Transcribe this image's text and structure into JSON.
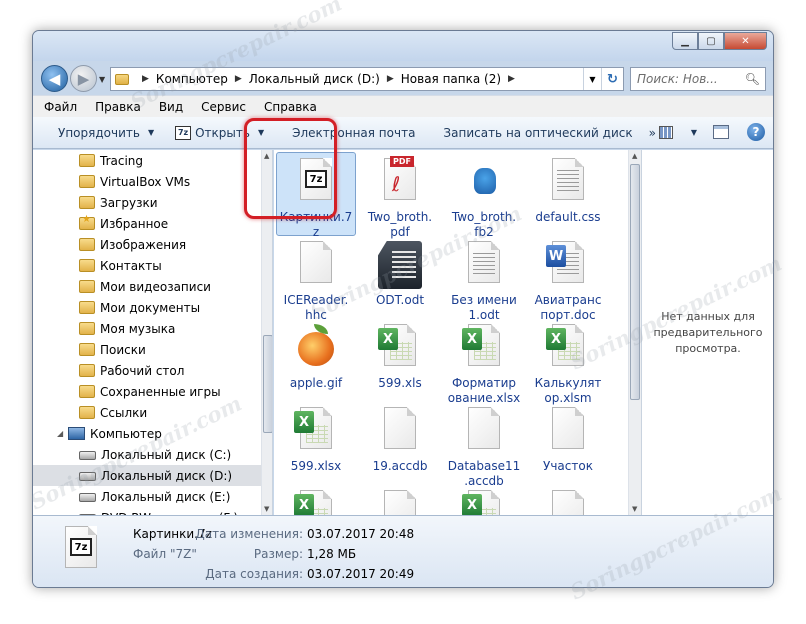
{
  "address": {
    "crumbs": [
      "Компьютер",
      "Локальный диск (D:)",
      "Новая папка (2)"
    ],
    "search_placeholder": "Поиск: Нов..."
  },
  "menu": [
    "Файл",
    "Правка",
    "Вид",
    "Сервис",
    "Справка"
  ],
  "toolbar": {
    "organize": "Упорядочить",
    "open": "Открыть",
    "open_icon": "7z",
    "email": "Электронная почта",
    "burn": "Записать на оптический диск"
  },
  "nav": {
    "items": [
      {
        "label": "Tracing",
        "icon": "folder"
      },
      {
        "label": "VirtualBox VMs",
        "icon": "folder"
      },
      {
        "label": "Загрузки",
        "icon": "folder"
      },
      {
        "label": "Избранное",
        "icon": "folder-star"
      },
      {
        "label": "Изображения",
        "icon": "folder"
      },
      {
        "label": "Контакты",
        "icon": "folder"
      },
      {
        "label": "Мои видеозаписи",
        "icon": "folder"
      },
      {
        "label": "Мои документы",
        "icon": "folder"
      },
      {
        "label": "Моя музыка",
        "icon": "folder"
      },
      {
        "label": "Поиски",
        "icon": "folder"
      },
      {
        "label": "Рабочий стол",
        "icon": "folder"
      },
      {
        "label": "Сохраненные игры",
        "icon": "folder"
      },
      {
        "label": "Ссылки",
        "icon": "folder"
      },
      {
        "label": "Компьютер",
        "icon": "computer"
      },
      {
        "label": "Локальный диск (C:)",
        "icon": "drive"
      },
      {
        "label": "Локальный диск (D:)",
        "icon": "drive"
      },
      {
        "label": "Локальный диск (E:)",
        "icon": "drive"
      },
      {
        "label": "DVD RW дисковод (F:)",
        "icon": "dvd"
      }
    ]
  },
  "files": [
    {
      "name": "Картинки.7z",
      "line1": "Картинки.7",
      "line2": "z",
      "type": "7z",
      "selected": true
    },
    {
      "name": "Two_broth.pdf",
      "line1": "Two_broth.",
      "line2": "pdf",
      "type": "pdf",
      "badge": "PDF"
    },
    {
      "name": "Two_broth.fb2",
      "line1": "Two_broth.",
      "line2": "fb2",
      "type": "fb2"
    },
    {
      "name": "default.css",
      "line1": "default.css",
      "line2": "",
      "type": "text"
    },
    {
      "name": "ICEReader.hhc",
      "line1": "ICEReader.",
      "line2": "hhc",
      "type": "blank"
    },
    {
      "name": "ODT.odt",
      "line1": "ODT.odt",
      "line2": "",
      "type": "odt"
    },
    {
      "name": "Без имени 1.odt",
      "line1": "Без имени",
      "line2": "1.odt",
      "type": "doc-grey"
    },
    {
      "name": "Авиатранспорт.doc",
      "line1": "Авиатранс",
      "line2": "порт.doc",
      "type": "word",
      "badge": "W"
    },
    {
      "name": "apple.gif",
      "line1": "apple.gif",
      "line2": "",
      "type": "image"
    },
    {
      "name": "599.xls",
      "line1": "599.xls",
      "line2": "",
      "type": "excel",
      "badge": "X"
    },
    {
      "name": "Форматирование.xlsx",
      "line1": "Форматир",
      "line2": "ование.xlsx",
      "type": "excel",
      "badge": "X"
    },
    {
      "name": "Калькулятор.xlsm",
      "line1": "Калькулят",
      "line2": "ор.xlsm",
      "type": "excel",
      "badge": "X"
    },
    {
      "name": "599.xlsx",
      "line1": "599.xlsx",
      "line2": "",
      "type": "excel",
      "badge": "X"
    },
    {
      "name": "19.accdb",
      "line1": "19.accdb",
      "line2": "",
      "type": "blank"
    },
    {
      "name": "Database11.accdb",
      "line1": "Database11",
      "line2": ".accdb",
      "type": "blank"
    },
    {
      "name": "Участок",
      "line1": "Участок",
      "line2": "",
      "type": "blank"
    },
    {
      "name": "",
      "line1": "",
      "line2": "",
      "type": "excel",
      "badge": "X"
    },
    {
      "name": "",
      "line1": "",
      "line2": "",
      "type": "blank"
    },
    {
      "name": "",
      "line1": "",
      "line2": "",
      "type": "excel",
      "badge": "X"
    },
    {
      "name": "",
      "line1": "",
      "line2": "",
      "type": "blank"
    }
  ],
  "preview": {
    "text": "Нет данных для предварительного просмотра."
  },
  "details": {
    "icon": "7z",
    "name": "Картинки.7z",
    "type": "Файл \"7Z\"",
    "labels": {
      "modified": "Дата изменения:",
      "size": "Размер:",
      "created": "Дата создания:"
    },
    "modified": "03.07.2017 20:48",
    "size": "1,28 МБ",
    "created": "03.07.2017 20:49"
  },
  "watermark": "Soringpcrepair.com",
  "colors": {
    "selection_ring": "#d31f26",
    "selection_fill": "#cde3f9",
    "link_text": "#1a3d8f"
  }
}
